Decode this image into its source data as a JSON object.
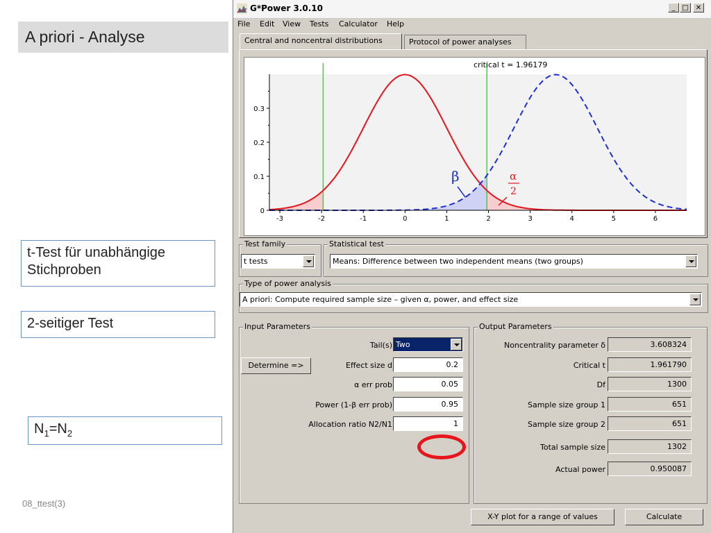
{
  "slide": {
    "title": "A priori - Analyse",
    "notes": [
      "t-Test für unabhängige Stichproben",
      "2-seitiger Test"
    ],
    "note3_main": "N",
    "note3_sub1": "1",
    "note3_eq": "=N",
    "note3_sub2": "2",
    "footer": "08_ttest(3)"
  },
  "window": {
    "title": "G*Power 3.0.10",
    "menu": [
      "File",
      "Edit",
      "View",
      "Tests",
      "Calculator",
      "Help"
    ],
    "tabs": [
      "Central and noncentral distributions",
      "Protocol of power analyses"
    ]
  },
  "chart_data": {
    "type": "line",
    "title": "critical t = 1.96179",
    "xlim": [
      -3.25,
      6.75
    ],
    "ylim": [
      0,
      0.4
    ],
    "xticks": [
      "-3",
      "-2",
      "-1",
      "0",
      "1",
      "2",
      "3",
      "4",
      "5",
      "6"
    ],
    "yticks": [
      "0",
      "0.1",
      "0.2",
      "0.3"
    ],
    "critical_values": [
      -1.96179,
      1.96179
    ],
    "series": [
      {
        "distribution": "central",
        "center": 0,
        "style": "solid",
        "color": "#e8141b"
      },
      {
        "distribution": "noncentral",
        "center": 3.608324,
        "style": "dashed",
        "color": "#1a2fd6"
      }
    ],
    "annotations": {
      "beta": "β",
      "alpha": "α",
      "alpha_den": "2"
    }
  },
  "test_family": {
    "label": "Test family",
    "value": "t tests"
  },
  "statistical_test": {
    "label": "Statistical test",
    "value": "Means: Difference between two independent means (two groups)"
  },
  "power_analysis": {
    "label": "Type of power analysis",
    "value": "A priori: Compute required sample size – given α, power, and effect size"
  },
  "input": {
    "label": "Input Parameters",
    "determine_button": "Determine =>",
    "tails_label": "Tail(s)",
    "tails_value": "Two",
    "effect_label": "Effect size d",
    "effect_value": "0.2",
    "alpha_label": "α err prob",
    "alpha_value": "0.05",
    "power_label": "Power (1-β err prob)",
    "power_value": "0.95",
    "alloc_label": "Allocation ratio N2/N1",
    "alloc_value": "1"
  },
  "output": {
    "label": "Output Parameters",
    "rows": [
      {
        "label": "Noncentrality parameter δ",
        "value": "3.608324"
      },
      {
        "label": "Critical t",
        "value": "1.961790"
      },
      {
        "label": "Df",
        "value": "1300"
      },
      {
        "label": "Sample size group 1",
        "value": "651"
      },
      {
        "label": "Sample size group 2",
        "value": "651"
      },
      {
        "label": "Total sample size",
        "value": "1302"
      },
      {
        "label": "Actual power",
        "value": "0.950087"
      }
    ]
  },
  "buttons": {
    "xy_plot": "X-Y plot for a range of values",
    "calculate": "Calculate"
  }
}
